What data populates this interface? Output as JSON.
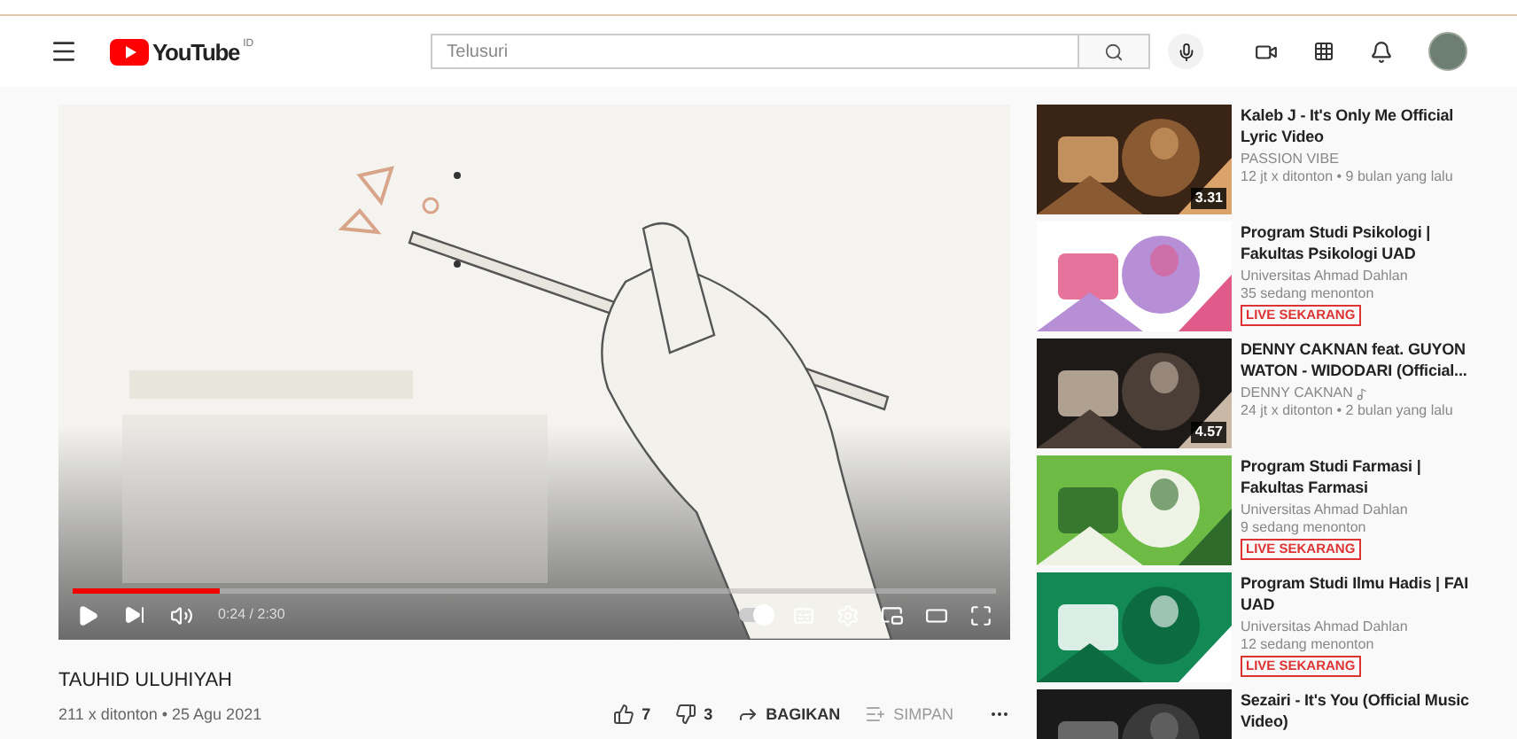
{
  "header": {
    "logo_text": "YouTube",
    "country": "ID",
    "search": {
      "placeholder": "Telusuri"
    }
  },
  "player": {
    "time": "0:24 / 2:30",
    "level": 0.16,
    "autoplay": true
  },
  "video": {
    "title": "TAUHID ULUHIYAH",
    "meta": "211 x ditonton • 25 Agu 2021",
    "likes": "7",
    "dislikes": "3",
    "share": "BAGIKAN",
    "save": "SIMPAN"
  },
  "recommendations": [
    {
      "kind": "video",
      "title": "Kaleb J - It's Only Me Official Lyric Video",
      "channel": "PASSION VIBE",
      "music_channel": false,
      "meta": "12 jt x ditonton • 9 bulan yang lalu",
      "duration": "3.31"
    },
    {
      "kind": "live",
      "title": "Program Studi Psikologi | Fakultas Psikologi UAD",
      "channel": "Universitas Ahmad Dahlan",
      "music_channel": false,
      "meta": "35 sedang menonton",
      "badge": "LIVE SEKARANG"
    },
    {
      "kind": "video",
      "title": "DENNY CAKNAN feat. GUYON WATON - WIDODARI (Official...",
      "channel": "DENNY CAKNAN",
      "music_channel": true,
      "meta": "24 jt x ditonton • 2 bulan yang lalu",
      "duration": "4.57"
    },
    {
      "kind": "live",
      "title": "Program Studi Farmasi | Fakultas Farmasi",
      "channel": "Universitas Ahmad Dahlan",
      "music_channel": false,
      "meta": "9 sedang menonton",
      "badge": "LIVE SEKARANG"
    },
    {
      "kind": "live",
      "title": "Program Studi Ilmu Hadis | FAI UAD",
      "channel": "Universitas Ahmad Dahlan",
      "music_channel": false,
      "meta": "12 sedang menonton",
      "badge": "LIVE SEKARANG"
    },
    {
      "kind": "video",
      "title": "Sezairi - It's You (Official Music Video)"
    }
  ]
}
